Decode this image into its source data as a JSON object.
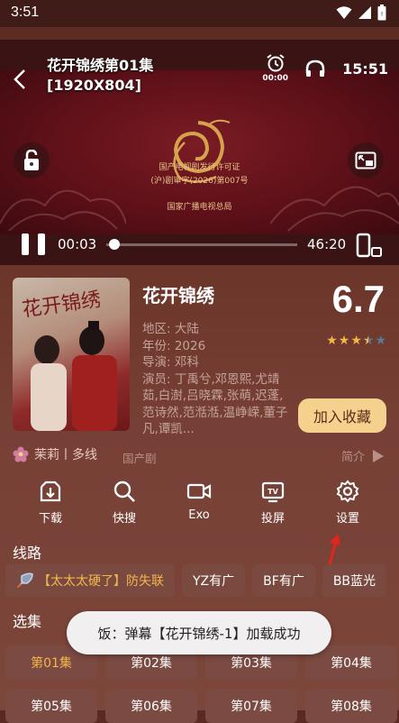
{
  "status_bar": {
    "time": "3:51"
  },
  "player": {
    "title_line1": "花开锦绣第01集",
    "title_line2": "[1920X804]",
    "alarm_time": "00:00",
    "clock_time": "15:51",
    "current_time": "00:03",
    "total_time": "46:20",
    "progress": 0.001,
    "license_line1": "国产电视剧发行许可证",
    "license_line2": "(沪)剧审字(2026)第007号",
    "license_line3": "国家广播电视总局"
  },
  "show": {
    "title": "花开锦绣",
    "rating": "6.7",
    "stars": 3.5,
    "region": "地区: 大陆",
    "year": "年份: 2026",
    "director": "导演: 邓科",
    "cast": "演员: 丁禹兮,邓恩熙,尤靖茹,白澍,吕晓霖,张萌,迟蓬,范诗然,范湉湉,温峥嵘,董子凡,谭凯...",
    "favorite_label": "加入收藏",
    "source": "茉莉丨多线",
    "genre": "国产剧",
    "intro_label": "简介",
    "poster_calligraphy": "花开锦绣"
  },
  "actions": [
    {
      "label": "下载",
      "icon": "download-icon"
    },
    {
      "label": "快搜",
      "icon": "search-icon"
    },
    {
      "label": "Exo",
      "icon": "video-camera-icon"
    },
    {
      "label": "投屏",
      "icon": "tv-cast-icon"
    },
    {
      "label": "设置",
      "icon": "gear-icon"
    }
  ],
  "routes_label": "线路",
  "routes": [
    {
      "label": "【太太太硬了】防失联",
      "active": true
    },
    {
      "label": "YZ有广"
    },
    {
      "label": "BF有广"
    },
    {
      "label": "BB蓝光"
    }
  ],
  "episodes_label": "选集",
  "episodes": [
    "第01集",
    "第02集",
    "第03集",
    "第04集",
    "第05集",
    "第06集",
    "第07集",
    "第08集"
  ],
  "toast": "饭：弹幕【花开锦绣-1】加载成功",
  "colors": {
    "accent": "#f2b64c",
    "favorite_bg": "#f4d28e",
    "arrow": "#e2261f"
  }
}
